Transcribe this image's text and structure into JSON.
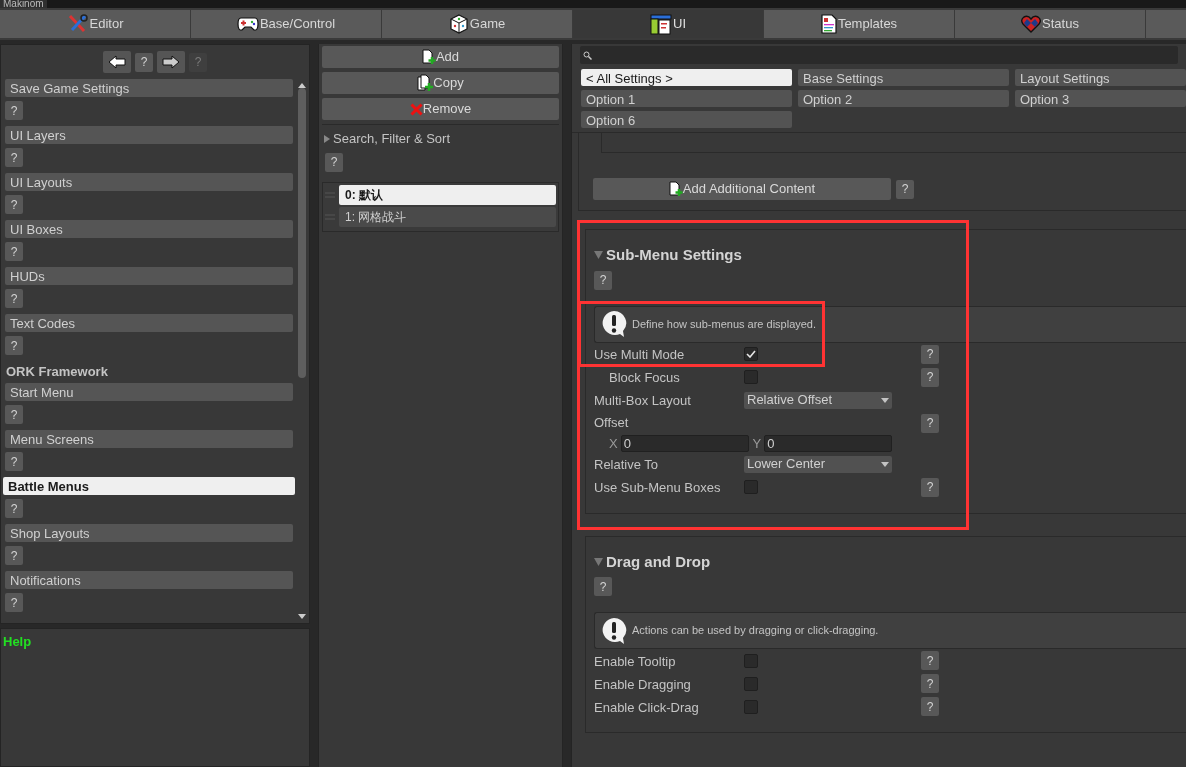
{
  "window": {
    "title": "Makinom"
  },
  "tabs": [
    {
      "label": "Editor",
      "selected": false
    },
    {
      "label": "Base/Control",
      "selected": false
    },
    {
      "label": "Game",
      "selected": false
    },
    {
      "label": "UI",
      "selected": true
    },
    {
      "label": "Templates",
      "selected": false
    },
    {
      "label": "Status",
      "selected": false
    },
    {
      "selected": false
    }
  ],
  "sidebar": {
    "nav": [
      {
        "kind": "back",
        "disabled": false
      },
      {
        "kind": "help",
        "label": "?",
        "disabled": false
      },
      {
        "kind": "forward",
        "disabled": false
      },
      {
        "kind": "help",
        "label": "?",
        "disabled": true
      }
    ],
    "items": [
      {
        "kind": "item",
        "label": "Save Game Settings",
        "help": "?",
        "selected": false
      },
      {
        "kind": "item",
        "label": "UI Layers",
        "help": "?",
        "selected": false
      },
      {
        "kind": "item",
        "label": "UI Layouts",
        "help": "?",
        "selected": false
      },
      {
        "kind": "item",
        "label": "UI Boxes",
        "help": "?",
        "selected": false
      },
      {
        "kind": "item",
        "label": "HUDs",
        "help": "?",
        "selected": false
      },
      {
        "kind": "item",
        "label": "Text Codes",
        "help": "?",
        "selected": false
      },
      {
        "kind": "header",
        "label": "ORK Framework"
      },
      {
        "kind": "item",
        "label": "Start Menu",
        "help": "?",
        "selected": false
      },
      {
        "kind": "item",
        "label": "Menu Screens",
        "help": "?",
        "selected": false
      },
      {
        "kind": "item",
        "label": "Battle Menus",
        "help": "?",
        "selected": true
      },
      {
        "kind": "item",
        "label": "Shop Layouts",
        "help": "?",
        "selected": false
      },
      {
        "kind": "item",
        "label": "Notifications",
        "help": "?",
        "selected": false
      }
    ],
    "help_title": "Help"
  },
  "middle": {
    "buttons": [
      {
        "label": "Add"
      },
      {
        "label": "Copy"
      },
      {
        "label": "Remove"
      }
    ],
    "filter": {
      "label": "Search, Filter & Sort",
      "expanded": false,
      "help": "?"
    },
    "entries": [
      {
        "label": "0: 默认",
        "selected": true
      },
      {
        "label": "1: 网格战斗",
        "selected": false
      }
    ]
  },
  "settings": {
    "filters": [
      {
        "label": "< All Settings >",
        "selected": true
      },
      {
        "label": "Base Settings",
        "selected": false
      },
      {
        "label": "Layout Settings",
        "selected": false
      },
      {
        "label": "Option 1",
        "selected": false
      },
      {
        "label": "Option 2",
        "selected": false
      },
      {
        "label": "Option 3",
        "selected": false
      },
      {
        "label": "Option 6",
        "selected": false
      }
    ],
    "add_content": {
      "label": "Add Additional Content",
      "help": "?"
    },
    "sections": [
      {
        "title": "Sub-Menu Settings",
        "expanded": true,
        "help": "?",
        "info": "Define how sub-menus are displayed.",
        "highlighted": true,
        "rows": [
          {
            "kind": "checkbox",
            "label": "Use Multi Mode",
            "checked": true,
            "help": "?",
            "highlighted": true,
            "children": [
              {
                "kind": "checkbox",
                "label": "Block Focus",
                "checked": false,
                "help": "?"
              }
            ]
          },
          {
            "kind": "dropdown",
            "label": "Multi-Box Layout",
            "value": "Relative Offset"
          },
          {
            "kind": "vector",
            "label": "Offset",
            "help": "?",
            "fields": [
              {
                "axis": "X",
                "value": "0"
              },
              {
                "axis": "Y",
                "value": "0"
              }
            ]
          },
          {
            "kind": "dropdown",
            "label": "Relative To",
            "value": "Lower Center"
          },
          {
            "kind": "checkbox",
            "label": "Use Sub-Menu Boxes",
            "checked": false,
            "help": "?",
            "highlighted": false
          }
        ]
      },
      {
        "title": "Drag and Drop",
        "expanded": true,
        "help": "?",
        "info": "Actions can be used by dragging or click-dragging.",
        "highlighted": false,
        "rows": [
          {
            "kind": "checkbox",
            "label": "Enable Tooltip",
            "checked": false,
            "help": "?",
            "highlighted": false
          },
          {
            "kind": "checkbox",
            "label": "Enable Dragging",
            "checked": false,
            "help": "?",
            "highlighted": false
          },
          {
            "kind": "checkbox",
            "label": "Enable Click-Drag",
            "checked": false,
            "help": "?",
            "highlighted": false
          }
        ]
      }
    ]
  }
}
